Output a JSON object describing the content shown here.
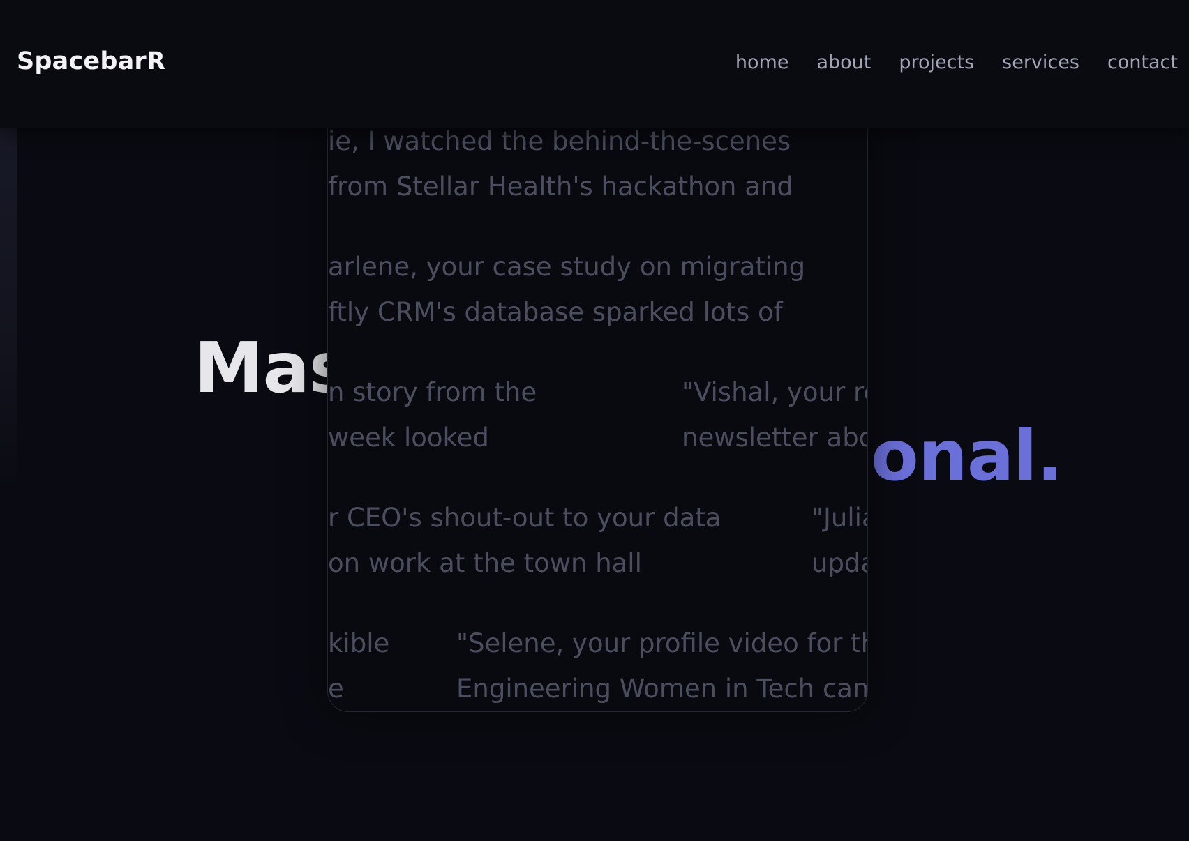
{
  "nav": {
    "logo": "SpacebarR",
    "links": [
      "home",
      "about",
      "projects",
      "services",
      "contact"
    ]
  },
  "hero": {
    "headline_visible_left": "Mas",
    "headline_visible_right": "onal."
  },
  "testimonials": [
    {
      "lines": [
        "ie, I watched the behind-the-scenes",
        " from Stellar Health's hackathon and"
      ]
    },
    {
      "lines": [
        "arlene, your case study on migrating",
        "ftly CRM's database sparked lots of"
      ]
    },
    {
      "lines": [
        "n story from the",
        " week looked"
      ]
    },
    {
      "lines": [
        "\"Vishal, your re",
        "newsletter abo"
      ]
    },
    {
      "lines": [
        "r CEO's shout-out to your data",
        "on work at the town hall"
      ]
    },
    {
      "lines": [
        "\"Julia",
        "upda"
      ]
    },
    {
      "lines": [
        "kible",
        "e"
      ]
    },
    {
      "lines": [
        "\"Selene, your profile video for th",
        "Engineering Women in Tech cam"
      ]
    }
  ],
  "colors": {
    "background": "#0a0b12",
    "accent": "#6b6fd8",
    "headline": "#e7e7eb",
    "nav_text": "#a1a5b6",
    "testimonial_text": "#4b4e5e"
  }
}
